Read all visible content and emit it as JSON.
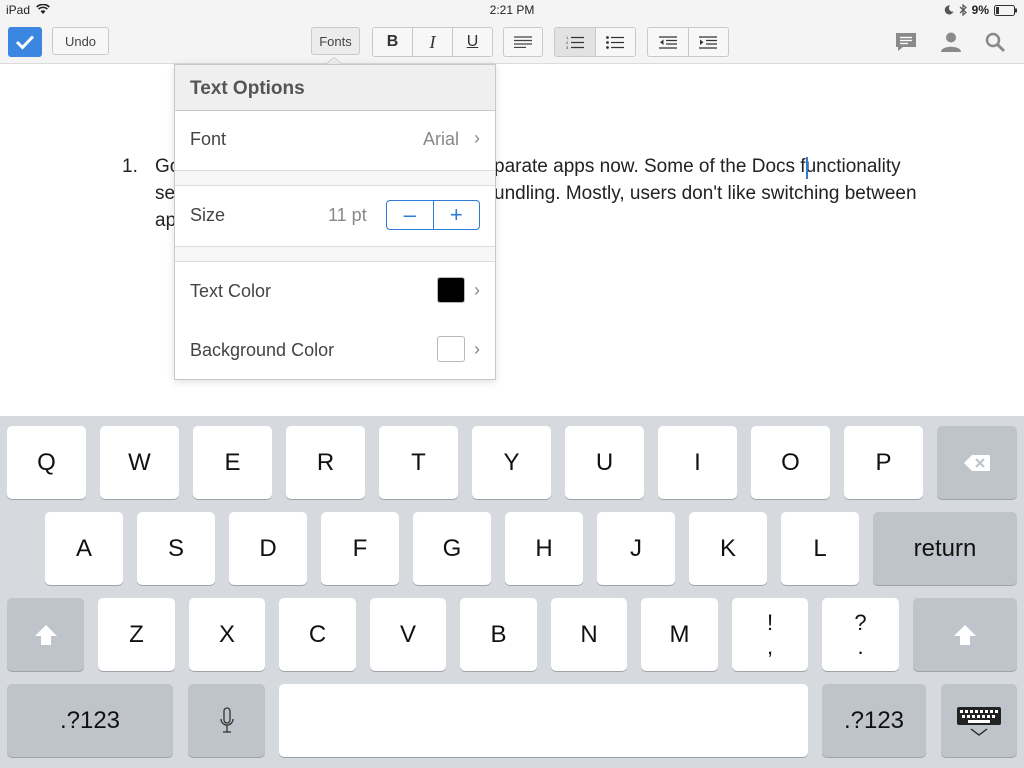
{
  "status": {
    "device": "iPad",
    "time": "2:21 PM",
    "battery": "9%"
  },
  "toolbar": {
    "undo": "Undo",
    "fonts": "Fonts",
    "bold": "B",
    "italic": "I",
    "underline": "U"
  },
  "doc": {
    "number": "1.",
    "line1a": "Go",
    "line1b": "parate apps now. Some of the Docs functionality",
    "line2a": "se",
    "line2b": "undling. Mostly, users don't like switching between",
    "line3a": "ap"
  },
  "popover": {
    "title": "Text Options",
    "font_label": "Font",
    "font_value": "Arial",
    "size_label": "Size",
    "size_value": "11 pt",
    "minus": "–",
    "plus": "+",
    "text_color_label": "Text Color",
    "text_color": "#000000",
    "bg_color_label": "Background Color",
    "bg_color": "#ffffff"
  },
  "keyboard": {
    "row1": [
      "Q",
      "W",
      "E",
      "R",
      "T",
      "Y",
      "U",
      "I",
      "O",
      "P"
    ],
    "row2": [
      "A",
      "S",
      "D",
      "F",
      "G",
      "H",
      "J",
      "K",
      "L"
    ],
    "row3": [
      "Z",
      "X",
      "C",
      "V",
      "B",
      "N",
      "M"
    ],
    "punct1": [
      "!",
      ","
    ],
    "punct2": [
      "?",
      "."
    ],
    "return": "return",
    "numbers": ".?123"
  },
  "accent": "#2c7bd6"
}
